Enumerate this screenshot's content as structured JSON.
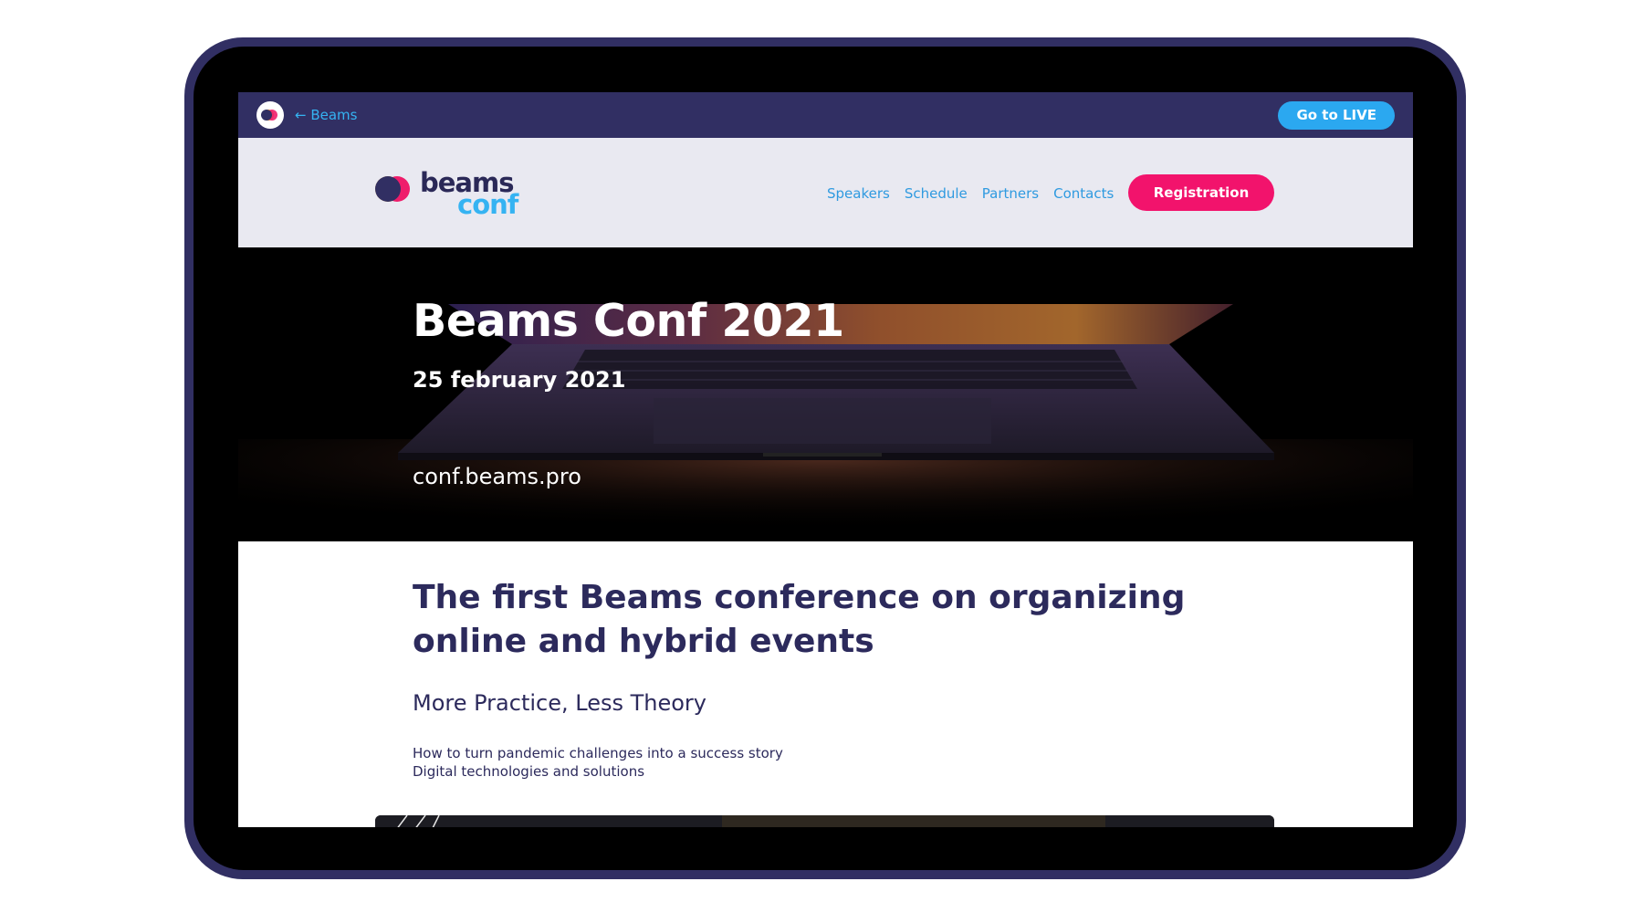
{
  "topbar": {
    "back_link": "← Beams",
    "live_button": "Go to LIVE"
  },
  "brand": {
    "word1": "beams",
    "word2": "conf"
  },
  "nav": {
    "items": [
      "Speakers",
      "Schedule",
      "Partners",
      "Contacts"
    ],
    "registration": "Registration"
  },
  "hero": {
    "title": "Beams Conf 2021",
    "date": "25 february 2021",
    "url": "conf.beams.pro"
  },
  "content": {
    "headline": "The first Beams conference on organizing online and hybrid events",
    "subheadline": "More Practice, Less Theory",
    "points": [
      "How to turn pandemic challenges into a success story",
      "Digital technologies and solutions"
    ]
  },
  "colors": {
    "frame": "#312f63",
    "accent_pink": "#f2136c",
    "accent_blue": "#2ba8f0",
    "navy_text": "#2c2a5c"
  }
}
